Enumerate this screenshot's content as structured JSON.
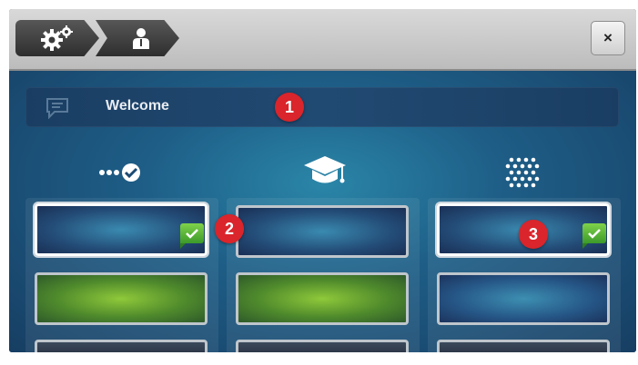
{
  "breadcrumb": {
    "items": [
      {
        "icon": "gears-icon"
      },
      {
        "icon": "user-icon"
      }
    ]
  },
  "close": {
    "label": "×"
  },
  "welcome": {
    "text": "Welcome",
    "icon": "message-icon"
  },
  "columns": [
    {
      "icon": "dots-check-icon",
      "tiles": [
        "blue-selected",
        "green",
        "dark"
      ]
    },
    {
      "icon": "graduation-cap-icon",
      "tiles": [
        "blue",
        "green",
        "dark"
      ]
    },
    {
      "icon": "dot-grid-icon",
      "tiles": [
        "blue-selected",
        "dots",
        "dark"
      ]
    }
  ],
  "badges": [
    "1",
    "2",
    "3"
  ],
  "colors": {
    "accent": "#d9252b",
    "check": "#5bb83a",
    "frame": "#1c3a5c"
  }
}
